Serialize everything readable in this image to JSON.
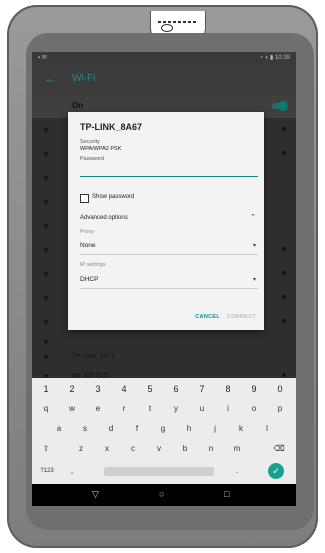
{
  "status": {
    "left": "▪ ✉",
    "right": "◔ ◗ ▮ 10:39"
  },
  "appbar": {
    "back": "←",
    "title": "Wi-Fi"
  },
  "wifi_toggle": {
    "label": "On"
  },
  "networks": [
    {
      "name": "TP-LINK_2071"
    },
    {
      "name": "diy_52F7CC"
    }
  ],
  "dialog": {
    "title": "TP-LINK_8A67",
    "security_label": "Security",
    "security_value": "WPA/WPA2 PSK",
    "password_label": "Password",
    "password_value": "",
    "show_password_label": "Show password",
    "advanced_label": "Advanced options",
    "proxy_label": "Proxy",
    "proxy_value": "None",
    "ip_label": "IP settings",
    "ip_value": "DHCP",
    "cancel_label": "CANCEL",
    "connect_label": "CONNECT"
  },
  "keyboard": {
    "numbers": [
      "1",
      "2",
      "3",
      "4",
      "5",
      "6",
      "7",
      "8",
      "9",
      "0"
    ],
    "row1": [
      "q",
      "w",
      "e",
      "r",
      "t",
      "y",
      "u",
      "i",
      "o",
      "p"
    ],
    "row2": [
      "a",
      "s",
      "d",
      "f",
      "g",
      "h",
      "j",
      "k",
      "l"
    ],
    "row3": [
      "⇧",
      "z",
      "x",
      "c",
      "v",
      "b",
      "n",
      "m",
      "⌫"
    ],
    "symbols_label": "?123",
    "comma": ",",
    "period": "."
  },
  "navbar": {
    "back": "▽",
    "home": "○",
    "recents": "□"
  }
}
